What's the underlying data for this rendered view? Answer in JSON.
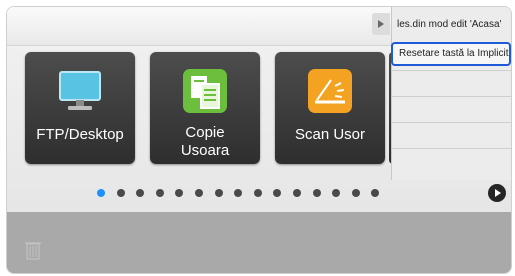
{
  "home": {
    "tiles": [
      {
        "label_line1": "FTP/Desktop",
        "label_line2": "",
        "icon": "monitor-icon"
      },
      {
        "label_line1": "Copie",
        "label_line2": "Usoara",
        "icon": "copy-icon"
      },
      {
        "label_line1": "Scan Usor",
        "label_line2": "",
        "icon": "scanner-icon"
      }
    ],
    "page_count": 15,
    "active_page": 1
  },
  "menu": {
    "items": [
      {
        "label": "les.din mod edit 'Acasa'"
      },
      {
        "label": "Resetare tastă la Implicit"
      }
    ]
  },
  "colors": {
    "active_dot": "#1e90ff",
    "highlight_border": "#1f5bd6"
  }
}
